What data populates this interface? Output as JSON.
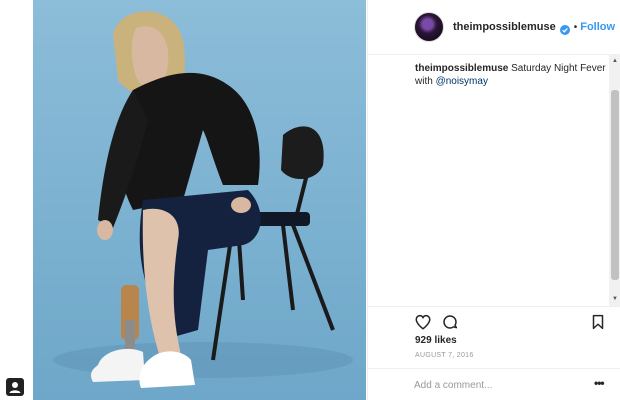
{
  "post": {
    "username": "theimpossiblemuse",
    "follow_label": "Follow",
    "separator": "•",
    "caption_user": "theimpossiblemuse",
    "caption_text": " Saturday Night Fever with ",
    "caption_mention": "@noisymay",
    "likes": "929 likes",
    "date": "AUGUST 7, 2016"
  },
  "comment": {
    "placeholder": "Add a comment..."
  },
  "icons": {
    "like": "heart-icon",
    "comment": "comment-icon",
    "save": "bookmark-icon",
    "verified": "verified-badge-icon",
    "more": "more-options-icon",
    "profile": "user-profile-icon"
  },
  "colors": {
    "link": "#3897f0",
    "mention": "#003569",
    "background_photo": "#7fb4d2"
  }
}
